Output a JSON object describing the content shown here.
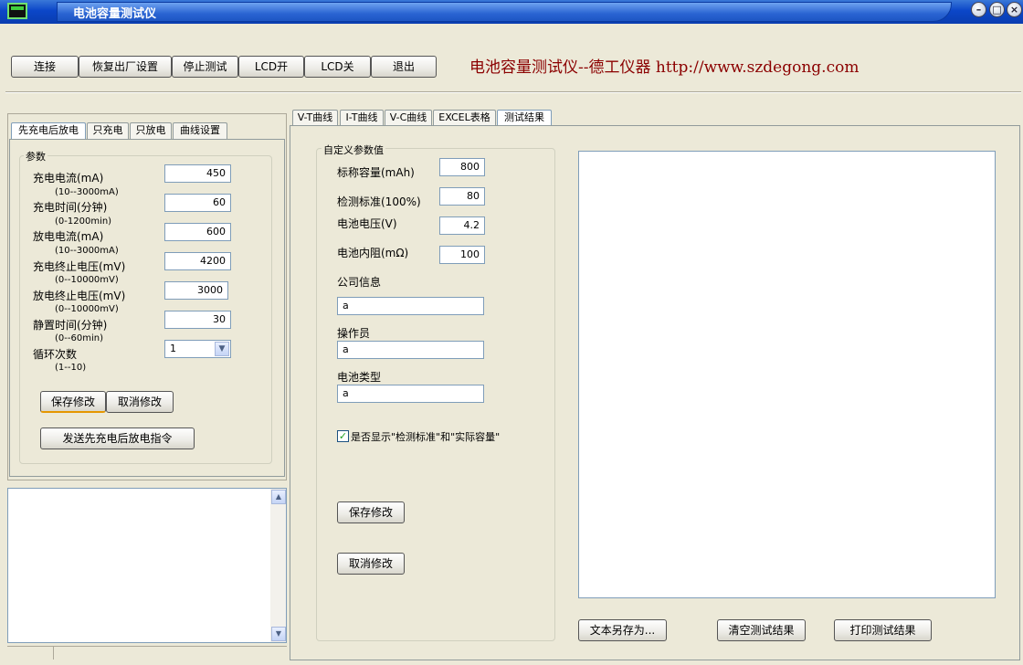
{
  "window": {
    "title": "电池容量测试仪",
    "minimize": "–",
    "maximize": "□",
    "close": "×"
  },
  "brand": {
    "text": "电池容量测试仪--德工仪器 http://www.szdegong.com",
    "color": "#8B0000"
  },
  "toolbar": {
    "connect": "连接",
    "restore": "恢复出厂设置",
    "stop": "停止测试",
    "lcd_on": "LCD开",
    "lcd_off": "LCD关",
    "exit": "退出"
  },
  "left_tabs": [
    "先充电后放电",
    "只充电",
    "只放电",
    "曲线设置"
  ],
  "params": {
    "group_label": "参数",
    "rows": [
      {
        "label": "充电电流(mA)",
        "hint": "(10--3000mA)",
        "value": "450"
      },
      {
        "label": "充电时间(分钟)",
        "hint": "(0-1200min)",
        "value": "60"
      },
      {
        "label": "放电电流(mA)",
        "hint": "(10--3000mA)",
        "value": "600"
      },
      {
        "label": "充电终止电压(mV)",
        "hint": "(0--10000mV)",
        "value": "4200"
      },
      {
        "label": "放电终止电压(mV)",
        "hint": "(0--10000mV)",
        "value": "3000"
      },
      {
        "label": "静置时间(分钟)",
        "hint": "(0--60min)",
        "value": "30"
      }
    ],
    "cycle": {
      "label": "循环次数",
      "hint": "(1--10)",
      "value": "1"
    },
    "save": "保存修改",
    "cancel": "取消修改",
    "send": "发送先充电后放电指令"
  },
  "right_tabs": [
    "V-T曲线",
    "I-T曲线",
    "V-C曲线",
    "EXCEL表格",
    "测试结果"
  ],
  "custom": {
    "group_label": "自定义参数值",
    "rows": [
      {
        "label": "标称容量(mAh)",
        "value": "800"
      },
      {
        "label": "检测标准(100%)",
        "value": "80"
      },
      {
        "label": "电池电压(V)",
        "value": "4.2"
      },
      {
        "label": "电池内阻(mΩ)",
        "value": "100"
      }
    ],
    "company_label": "公司信息",
    "company_value": "a",
    "operator_label": "操作员",
    "operator_value": "a",
    "battery_type_label": "电池类型",
    "battery_type_value": "a",
    "show_check_label": "是否显示\"检测标准\"和\"实际容量\"",
    "save": "保存修改",
    "cancel": "取消修改"
  },
  "result_buttons": {
    "save_as": "文本另存为...",
    "clear": "清空测试结果",
    "print": "打印测试结果"
  }
}
